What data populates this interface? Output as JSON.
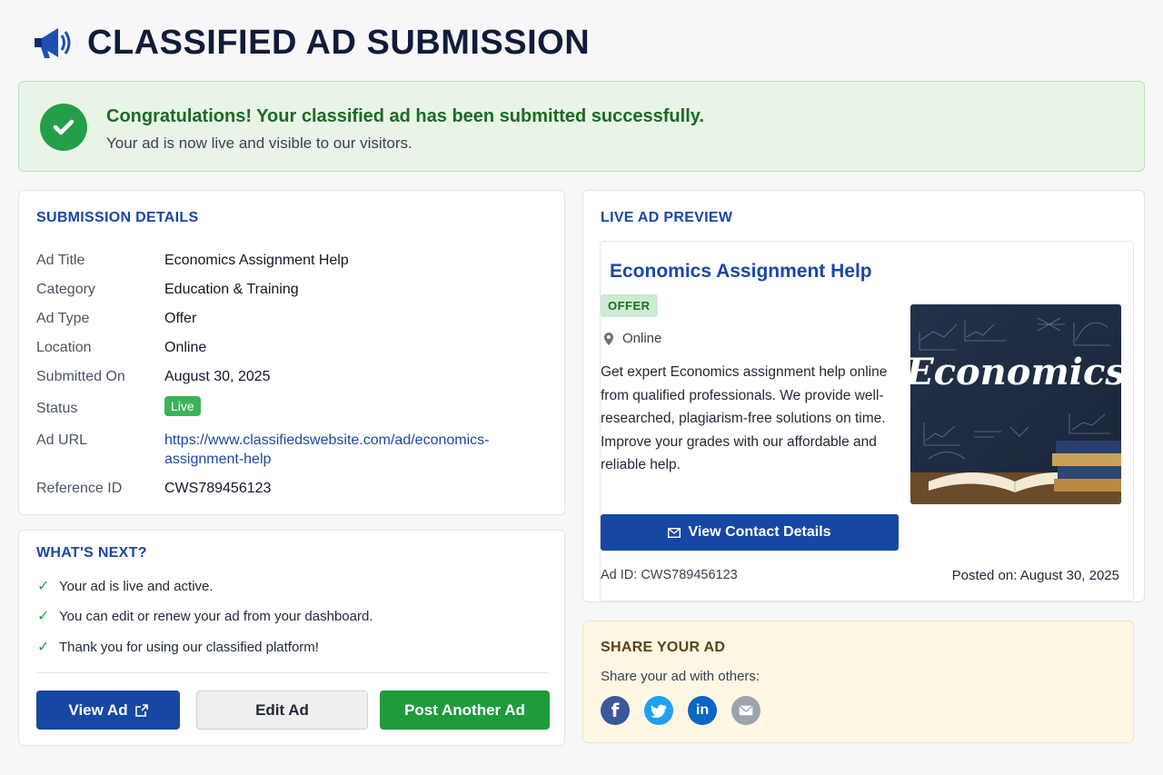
{
  "header": {
    "title": "CLASSIFIED AD SUBMISSION",
    "icon": "megaphone-icon"
  },
  "banner": {
    "headline": "Congratulations! Your classified ad has been submitted successfully.",
    "subtext": "Your ad is now live and visible to our visitors."
  },
  "details": {
    "title": "SUBMISSION DETAILS",
    "rows": [
      {
        "label": "Ad Title",
        "value": "Economics Assignment Help"
      },
      {
        "label": "Category",
        "value": "Education & Training"
      },
      {
        "label": "Ad Type",
        "value": "Offer"
      },
      {
        "label": "Location",
        "value": "Online"
      },
      {
        "label": "Submitted On",
        "value": "August 30, 2025"
      },
      {
        "label": "Status",
        "value": "Live"
      },
      {
        "label": "Ad URL",
        "value": "https://www.classifiedswebsite.com/ad/economics-assignment-help"
      },
      {
        "label": "Reference ID",
        "value": "CWS789456123"
      }
    ]
  },
  "next": {
    "title": "WHAT'S NEXT?",
    "items": [
      "Your ad is live and active.",
      "You can edit or renew your ad from your dashboard.",
      "Thank you for using our classified platform!"
    ],
    "buttons": {
      "view": "View Ad",
      "edit": "Edit Ad",
      "post": "Post Another Ad"
    }
  },
  "preview": {
    "title": "LIVE AD PREVIEW",
    "ad_title": "Economics Assignment Help",
    "badge": "OFFER",
    "location": "Online",
    "description": "Get expert Economics assignment help online from qualified professionals. We provide well-researched, plagiarism-free solutions on time. Improve your grades with our affordable and reliable help.",
    "image_text": "Economics",
    "contact_button": "View Contact Details",
    "ad_id": "Ad ID: CWS789456123",
    "posted": "Posted on: August 30, 2025"
  },
  "share": {
    "title": "SHARE YOUR AD",
    "subtitle": "Share your ad with others:",
    "networks": [
      "facebook-icon",
      "twitter-icon",
      "linkedin-icon",
      "email-icon"
    ]
  },
  "colors": {
    "primary": "#1648a3",
    "success": "#1f9b3c",
    "title_blue": "#1a47a5"
  }
}
